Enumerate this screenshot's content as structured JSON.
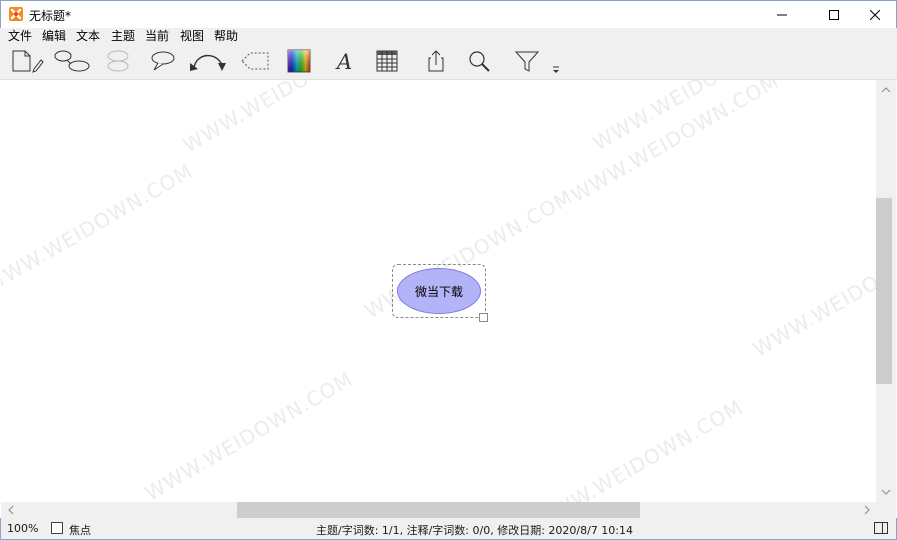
{
  "window": {
    "title": "无标题*",
    "icon": "app-logo-icon",
    "controls": [
      "minimize-icon",
      "maximize-icon",
      "close-icon"
    ]
  },
  "menu": {
    "items": [
      "文件",
      "编辑",
      "文本",
      "主题",
      "当前",
      "视图",
      "帮助"
    ]
  },
  "toolbar": {
    "tools": [
      "new-document-icon",
      "add-subtopic-icon",
      "add-sibling-icon",
      "callout-icon",
      "relationship-arrow-icon",
      "boundary-icon",
      "color-gradient-icon",
      "font-icon",
      "table-icon",
      "export-icon",
      "search-icon",
      "filter-icon",
      "toolbar-overflow-icon"
    ]
  },
  "canvas": {
    "topic": {
      "label": "微当下载",
      "fill": "#b3b3f7"
    },
    "watermark_text": "WWW.WEIDOWN.COM"
  },
  "status": {
    "zoom": "100%",
    "focus_label": "焦点",
    "focus_checked": false,
    "info": "主题/字词数: 1/1, 注释/字词数: 0/0, 修改日期: 2020/8/7 10:14"
  }
}
